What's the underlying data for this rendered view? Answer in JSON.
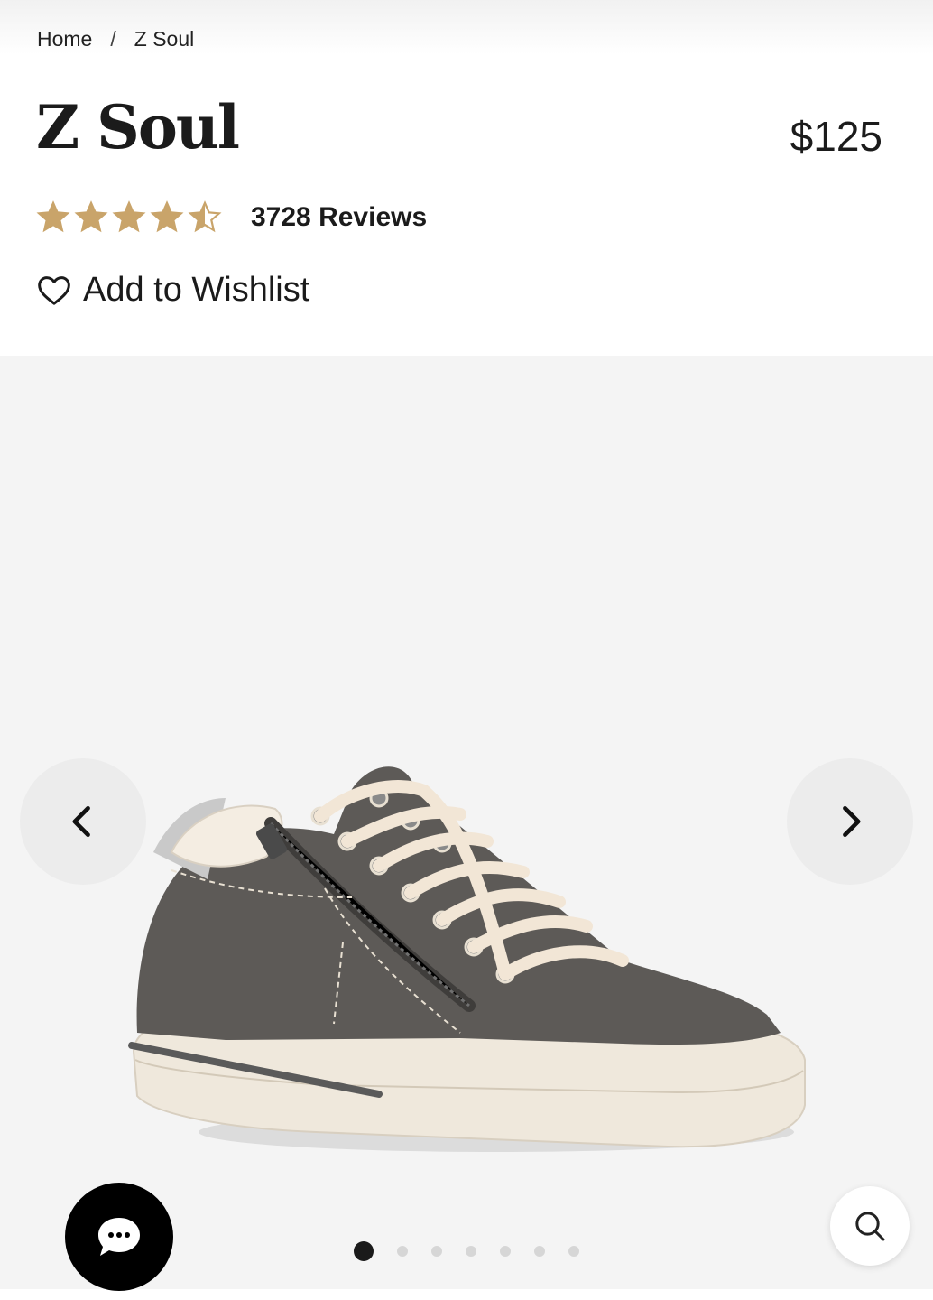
{
  "breadcrumb": {
    "home": "Home",
    "separator": "/",
    "current": "Z Soul"
  },
  "product": {
    "title": "Z Soul",
    "price": "$125",
    "rating": 4.5,
    "rating_max": 5,
    "reviews_label": "3728 Reviews",
    "wishlist_label": "Add to Wishlist"
  },
  "gallery": {
    "image_count": 7,
    "active_index": 0
  },
  "icons": {
    "star": "star-icon",
    "wishlist": "heart-icon",
    "prev": "chevron-left-icon",
    "next": "chevron-right-icon",
    "chat": "chat-bubble-icon",
    "search": "search-icon"
  },
  "colors": {
    "star": "#C9A46A",
    "text": "#1b1b1b",
    "gallery_bg": "#f4f4f4"
  }
}
